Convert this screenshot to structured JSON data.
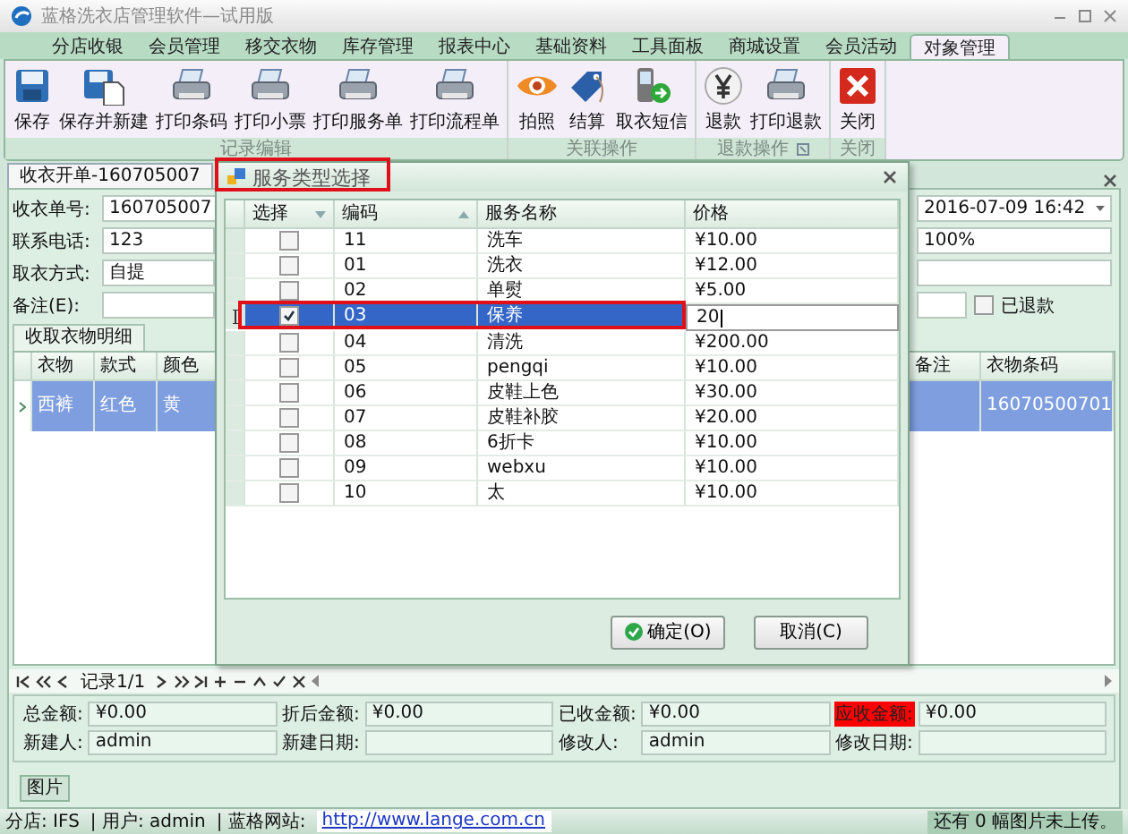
{
  "window": {
    "title": "蓝格洗衣店管理软件—试用版"
  },
  "menu_tabs": [
    {
      "label": "分店收银",
      "selected": false
    },
    {
      "label": "会员管理",
      "selected": false
    },
    {
      "label": "移交衣物",
      "selected": false
    },
    {
      "label": "库存管理",
      "selected": false
    },
    {
      "label": "报表中心",
      "selected": false
    },
    {
      "label": "基础资料",
      "selected": false
    },
    {
      "label": "工具面板",
      "selected": false
    },
    {
      "label": "商城设置",
      "selected": false
    },
    {
      "label": "会员活动",
      "selected": false
    },
    {
      "label": "对象管理",
      "selected": true
    }
  ],
  "ribbon_groups": [
    {
      "title": "记录编辑",
      "launcher": false,
      "buttons": [
        {
          "label": "保存",
          "kind": "save"
        },
        {
          "label": "保存并新建",
          "kind": "save_new"
        },
        {
          "label": "打印条码",
          "kind": "print"
        },
        {
          "label": "打印小票",
          "kind": "print"
        },
        {
          "label": "打印服务单",
          "kind": "print"
        },
        {
          "label": "打印流程单",
          "kind": "print"
        }
      ]
    },
    {
      "title": "关联操作",
      "launcher": false,
      "buttons": [
        {
          "label": "拍照",
          "kind": "eye"
        },
        {
          "label": "结算",
          "kind": "tag"
        },
        {
          "label": "取衣短信",
          "kind": "phone"
        }
      ]
    },
    {
      "title": "退款操作",
      "launcher": true,
      "buttons": [
        {
          "label": "退款",
          "kind": "yen"
        },
        {
          "label": "打印退款",
          "kind": "print"
        }
      ]
    },
    {
      "title": "关闭",
      "launcher": false,
      "buttons": [
        {
          "label": "关闭",
          "kind": "close"
        }
      ]
    }
  ],
  "document_tab": {
    "label": "收衣开单-160705007"
  },
  "form": {
    "left_fields": [
      {
        "label": "收衣单号:",
        "value": "160705007"
      },
      {
        "label": "联系电话:",
        "value": "123"
      },
      {
        "label": "取衣方式:",
        "value": "自提"
      },
      {
        "label": "备注(E):"
      }
    ],
    "right_fields": [
      {
        "kind": "dropdown",
        "value": "2016-07-09 16:42"
      },
      {
        "kind": "text",
        "value": "100%"
      },
      {
        "kind": "text"
      },
      {
        "kind": "checkbox",
        "label": "已退款",
        "checked": false
      }
    ]
  },
  "detail_tab": {
    "label": "收取衣物明细"
  },
  "detail_grid": {
    "left_columns": [
      "衣物",
      "款式",
      "颜色"
    ],
    "right_columns": [
      "备注",
      "衣物条码"
    ],
    "rows": [
      {
        "item": "西裤",
        "style": "红色",
        "shade": "黄",
        "barcode": "16070500701",
        "selected": true
      }
    ]
  },
  "navigator": {
    "record": "记录1/1"
  },
  "totals": [
    {
      "label": "总金额:",
      "value": "¥0.00",
      "highlight": false
    },
    {
      "label": "折后金额:",
      "value": "¥0.00",
      "highlight": false
    },
    {
      "label": "已收金额:",
      "value": "¥0.00",
      "highlight": false
    },
    {
      "label": "应收金额:",
      "value": "¥0.00",
      "highlight": true
    },
    {
      "label": "新建人:",
      "value": "admin",
      "highlight": false
    },
    {
      "label": "新建日期:",
      "highlight": false
    },
    {
      "label": "修改人:",
      "value": "admin",
      "highlight": false
    },
    {
      "label": "修改日期:",
      "highlight": false
    }
  ],
  "picture_tab": {
    "label": "图片"
  },
  "status_bar": {
    "branch": "分店: IFS",
    "user": "| 用户: admin",
    "site_label": "| 蓝格网站:",
    "site_link": "http://www.lange.com.cn",
    "upload_note": "还有 0 幅图片未上传。"
  },
  "dialog": {
    "title": "服务类型选择",
    "title_annotated": true,
    "columns": [
      {
        "label": "选择",
        "filter_arrow": true,
        "sorted": false
      },
      {
        "label": "编码",
        "filter_arrow": false,
        "sorted": true
      },
      {
        "label": "服务名称",
        "filter_arrow": false,
        "sorted": false
      },
      {
        "label": "价格",
        "filter_arrow": false,
        "sorted": false
      }
    ],
    "rows": [
      {
        "checked": false,
        "code": "11",
        "name": "洗车",
        "price": "¥10.00",
        "selected": false,
        "editing": false,
        "annotated": false
      },
      {
        "checked": false,
        "code": "01",
        "name": "洗衣",
        "price": "¥12.00",
        "selected": false,
        "editing": false,
        "annotated": false
      },
      {
        "checked": false,
        "code": "02",
        "name": "单熨",
        "price": "¥5.00",
        "selected": false,
        "editing": false,
        "annotated": false
      },
      {
        "checked": true,
        "code": "03",
        "name": "保养",
        "price": "20",
        "selected": true,
        "editing": true,
        "annotated": true
      },
      {
        "checked": false,
        "code": "04",
        "name": "清洗",
        "price": "¥200.00",
        "selected": false,
        "editing": false,
        "annotated": false
      },
      {
        "checked": false,
        "code": "05",
        "name": "pengqi",
        "price": "¥10.00",
        "selected": false,
        "editing": false,
        "annotated": false
      },
      {
        "checked": false,
        "code": "06",
        "name": "皮鞋上色",
        "price": "¥30.00",
        "selected": false,
        "editing": false,
        "annotated": false
      },
      {
        "checked": false,
        "code": "07",
        "name": "皮鞋补胶",
        "price": "¥20.00",
        "selected": false,
        "editing": false,
        "annotated": false
      },
      {
        "checked": false,
        "code": "08",
        "name": "6折卡",
        "price": "¥10.00",
        "selected": false,
        "editing": false,
        "annotated": false
      },
      {
        "checked": false,
        "code": "09",
        "name": "webxu",
        "price": "¥10.00",
        "selected": false,
        "editing": false,
        "annotated": false
      },
      {
        "checked": false,
        "code": "10",
        "name": "太",
        "price": "¥10.00",
        "selected": false,
        "editing": false,
        "annotated": false
      }
    ],
    "buttons": [
      {
        "label": "确定(O)",
        "kind": "ok"
      },
      {
        "label": "取消(C)",
        "kind": "cancel"
      }
    ]
  }
}
